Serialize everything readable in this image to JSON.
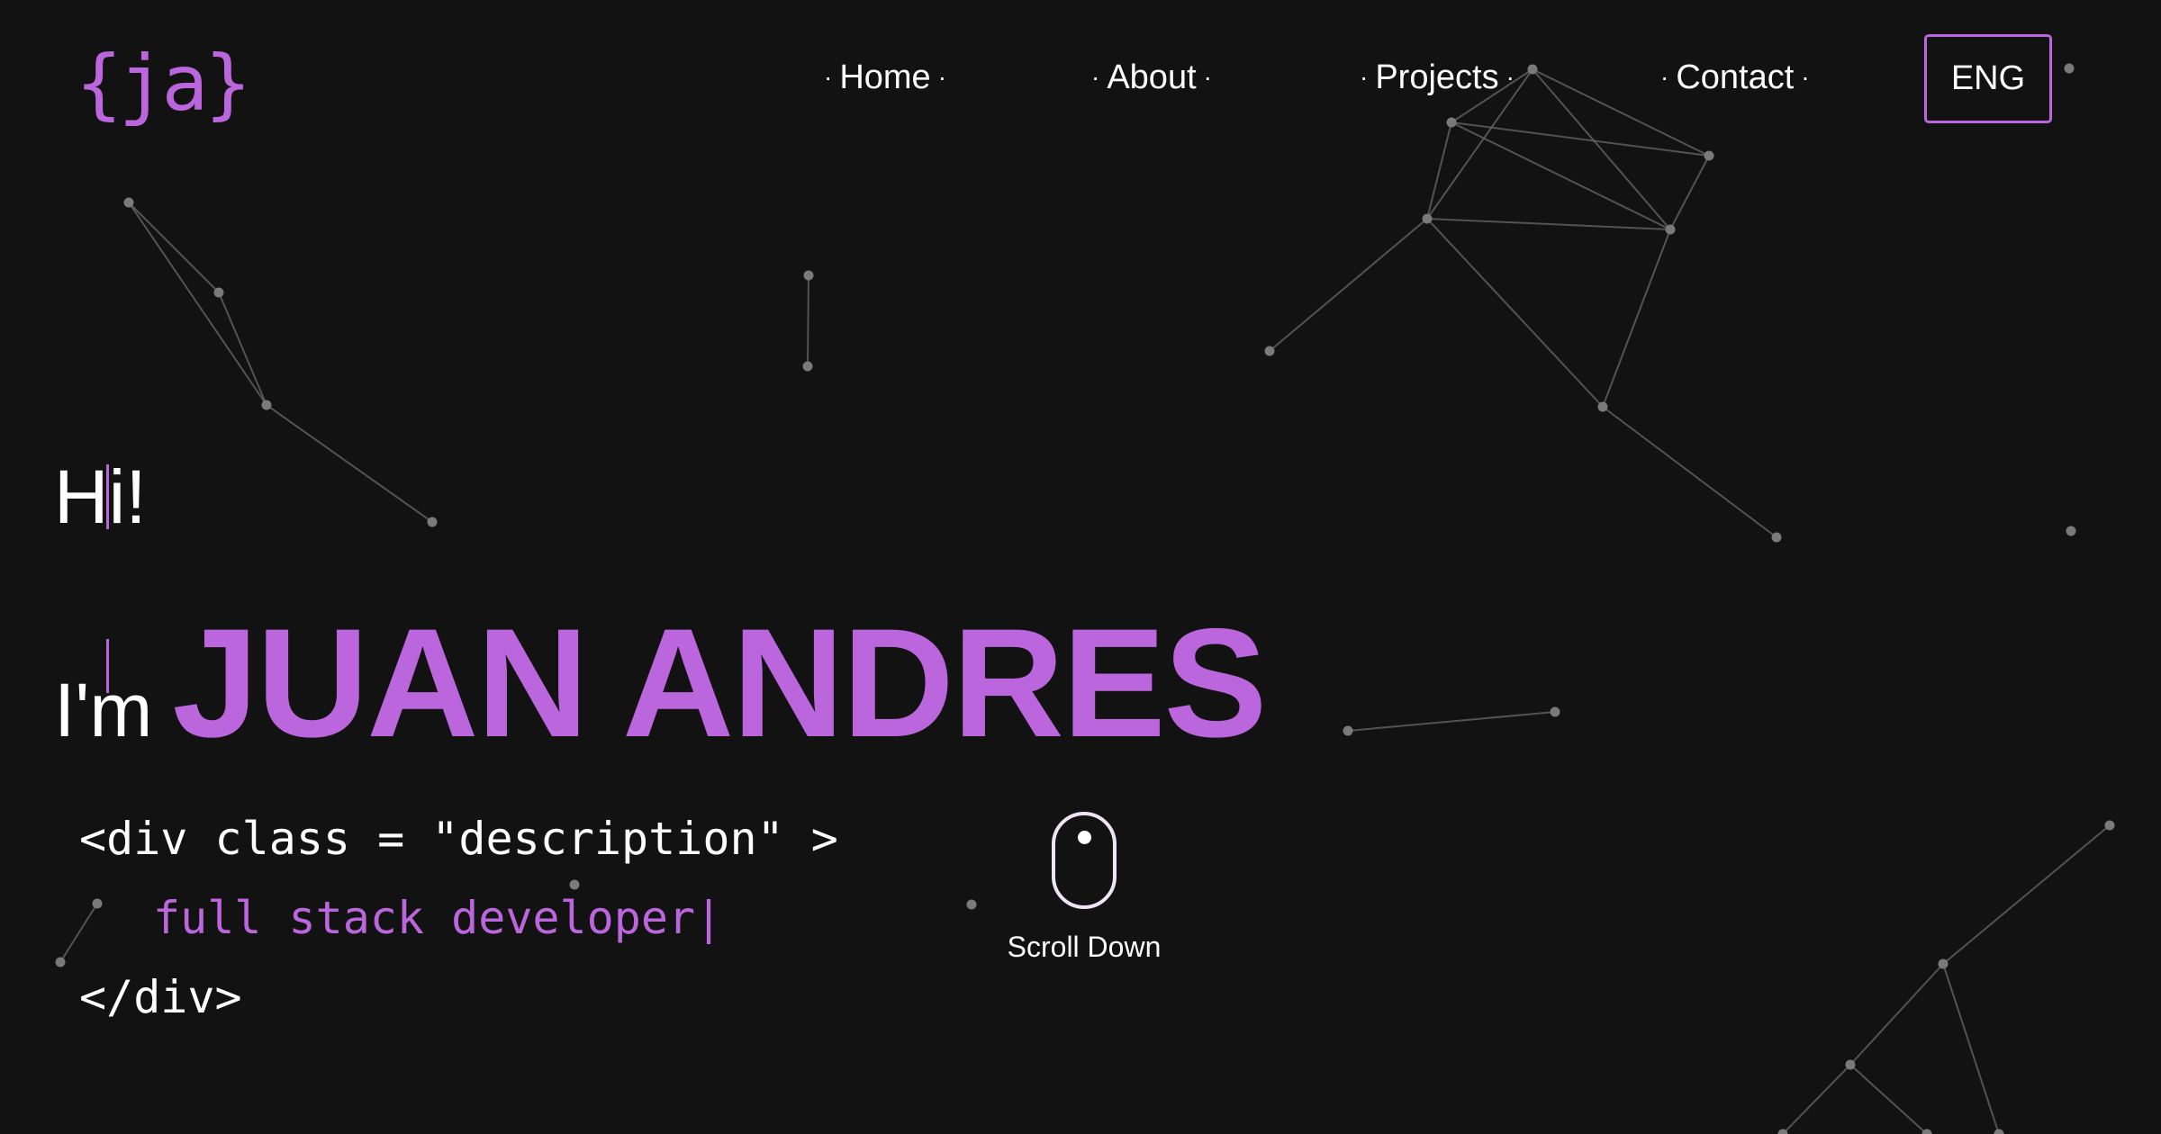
{
  "colors": {
    "background": "#121212",
    "accent": "#bb66dd",
    "text": "#ffffff",
    "network_line": "#6a6a6a",
    "network_node": "#7a7a7a"
  },
  "logo": {
    "text": "{ja}"
  },
  "nav": {
    "items": [
      {
        "label": "Home"
      },
      {
        "label": "About"
      },
      {
        "label": "Projects"
      },
      {
        "label": "Contact"
      }
    ],
    "separator": "·",
    "language": "ENG"
  },
  "hero": {
    "greeting": "Hi!",
    "im": "I'm",
    "name": "JUAN ANDRES",
    "code": {
      "open_tag": "<div class = \"description\" >",
      "content": "full stack developer|",
      "close_tag": "</div>"
    }
  },
  "scroll": {
    "icon": "mouse-icon",
    "label": "Scroll Down"
  }
}
